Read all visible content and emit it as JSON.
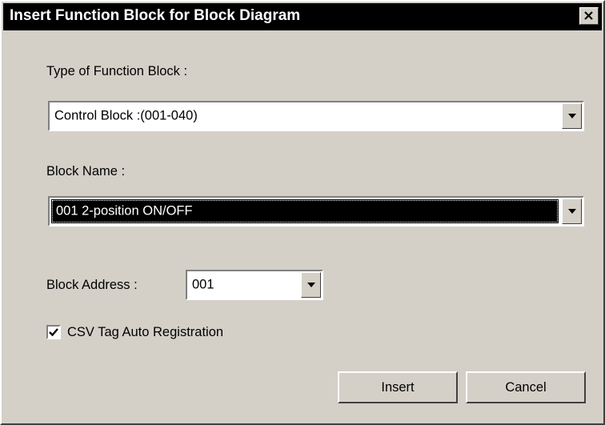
{
  "window": {
    "title": "Insert Function Block for Block Diagram",
    "close_glyph": "✕"
  },
  "type_of_function_block": {
    "label": "Type of Function Block :",
    "selected_value": "Control Block :(001-040)"
  },
  "block_name": {
    "label": "Block Name :",
    "selected_value": "001  2-position ON/OFF"
  },
  "block_address": {
    "label": "Block Address :",
    "selected_value": "001"
  },
  "csv_tag_auto_registration": {
    "label": "CSV Tag Auto Registration",
    "checked": true
  },
  "buttons": {
    "insert_label": "Insert",
    "cancel_label": "Cancel"
  },
  "icons": {
    "close": "close-icon",
    "dropdown": "chevron-down-icon",
    "checkmark": "checkmark-icon"
  },
  "colors": {
    "dialog_background": "#d4d0c8",
    "titlebar_background": "#000000",
    "selection_background": "#000000"
  }
}
